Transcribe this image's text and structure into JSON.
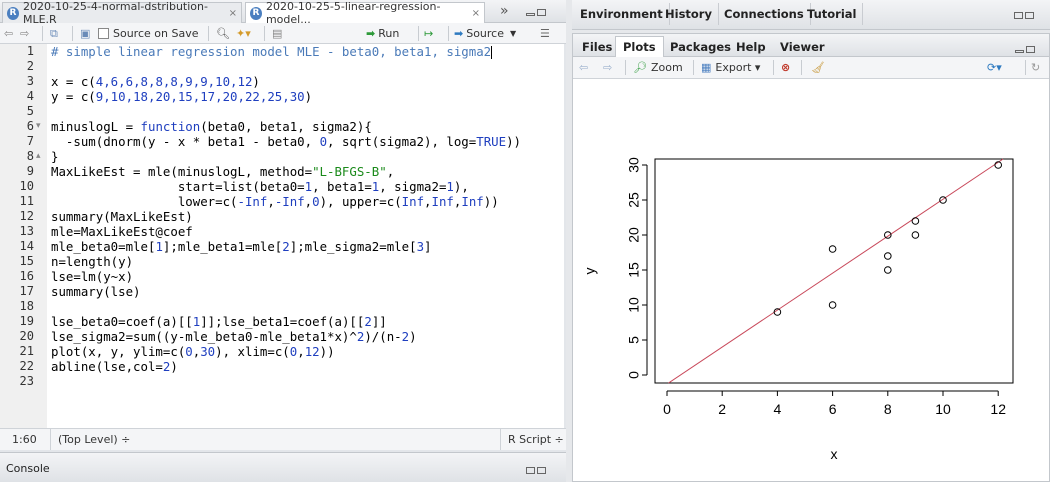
{
  "editor": {
    "tabs": [
      {
        "label": "2020-10-25-4-normal-dstribution-MLE.R",
        "close": "×"
      },
      {
        "label": "2020-10-25-5-linear-regression-model...",
        "close": "×"
      }
    ],
    "tab_overflow": "»",
    "toolbar": {
      "source_on_save": "Source on Save",
      "run": "Run",
      "source": "Source"
    },
    "lines": [
      {
        "n": "1",
        "fold": ""
      },
      {
        "n": "2",
        "fold": ""
      },
      {
        "n": "3",
        "fold": ""
      },
      {
        "n": "4",
        "fold": ""
      },
      {
        "n": "5",
        "fold": ""
      },
      {
        "n": "6",
        "fold": "▾"
      },
      {
        "n": "7",
        "fold": ""
      },
      {
        "n": "8",
        "fold": "▴"
      },
      {
        "n": "9",
        "fold": ""
      },
      {
        "n": "10",
        "fold": ""
      },
      {
        "n": "11",
        "fold": ""
      },
      {
        "n": "12",
        "fold": ""
      },
      {
        "n": "13",
        "fold": ""
      },
      {
        "n": "14",
        "fold": ""
      },
      {
        "n": "15",
        "fold": ""
      },
      {
        "n": "16",
        "fold": ""
      },
      {
        "n": "17",
        "fold": ""
      },
      {
        "n": "18",
        "fold": ""
      },
      {
        "n": "19",
        "fold": ""
      },
      {
        "n": "20",
        "fold": ""
      },
      {
        "n": "21",
        "fold": ""
      },
      {
        "n": "22",
        "fold": ""
      },
      {
        "n": "23",
        "fold": ""
      }
    ],
    "code": [
      [
        {
          "t": "# simple linear regression model MLE - beta0, beta1, sigma2",
          "c": "cm"
        }
      ],
      [],
      [
        {
          "t": "x = c(",
          "c": ""
        },
        {
          "t": "4,6,6,8,8,8,9,9,10,12",
          "c": "num"
        },
        {
          "t": ")",
          "c": ""
        }
      ],
      [
        {
          "t": "y = c(",
          "c": ""
        },
        {
          "t": "9,10,18,20,15,17,20,22,25,30",
          "c": "num"
        },
        {
          "t": ")",
          "c": ""
        }
      ],
      [],
      [
        {
          "t": "minuslogL = ",
          "c": ""
        },
        {
          "t": "function",
          "c": "kw"
        },
        {
          "t": "(beta0, beta1, sigma2){",
          "c": ""
        }
      ],
      [
        {
          "t": "  -sum(dnorm(y - x * beta1 - beta0, ",
          "c": ""
        },
        {
          "t": "0",
          "c": "num"
        },
        {
          "t": ", sqrt(sigma2), log=",
          "c": ""
        },
        {
          "t": "TRUE",
          "c": "kw"
        },
        {
          "t": "))",
          "c": ""
        }
      ],
      [
        {
          "t": "}",
          "c": ""
        }
      ],
      [
        {
          "t": "MaxLikeEst = mle(minuslogL, method=",
          "c": ""
        },
        {
          "t": "\"L-BFGS-B\"",
          "c": "str"
        },
        {
          "t": ",",
          "c": ""
        }
      ],
      [
        {
          "t": "                 start=list(beta0=",
          "c": ""
        },
        {
          "t": "1",
          "c": "num"
        },
        {
          "t": ", beta1=",
          "c": ""
        },
        {
          "t": "1",
          "c": "num"
        },
        {
          "t": ", sigma2=",
          "c": ""
        },
        {
          "t": "1",
          "c": "num"
        },
        {
          "t": "),",
          "c": ""
        }
      ],
      [
        {
          "t": "                 lower=c(",
          "c": ""
        },
        {
          "t": "-Inf",
          "c": "kw"
        },
        {
          "t": ",",
          "c": ""
        },
        {
          "t": "-Inf",
          "c": "kw"
        },
        {
          "t": ",",
          "c": ""
        },
        {
          "t": "0",
          "c": "num"
        },
        {
          "t": "), upper=c(",
          "c": ""
        },
        {
          "t": "Inf",
          "c": "kw"
        },
        {
          "t": ",",
          "c": ""
        },
        {
          "t": "Inf",
          "c": "kw"
        },
        {
          "t": ",",
          "c": ""
        },
        {
          "t": "Inf",
          "c": "kw"
        },
        {
          "t": "))",
          "c": ""
        }
      ],
      [
        {
          "t": "summary(MaxLikeEst)",
          "c": ""
        }
      ],
      [
        {
          "t": "mle=MaxLikeEst@coef",
          "c": ""
        }
      ],
      [
        {
          "t": "mle_beta0=mle[",
          "c": ""
        },
        {
          "t": "1",
          "c": "num"
        },
        {
          "t": "];mle_beta1=mle[",
          "c": ""
        },
        {
          "t": "2",
          "c": "num"
        },
        {
          "t": "];mle_sigma2=mle[",
          "c": ""
        },
        {
          "t": "3",
          "c": "num"
        },
        {
          "t": "]",
          "c": ""
        }
      ],
      [
        {
          "t": "n=length(y)",
          "c": ""
        }
      ],
      [
        {
          "t": "lse=lm(y~x)",
          "c": ""
        }
      ],
      [
        {
          "t": "summary(lse)",
          "c": ""
        }
      ],
      [],
      [
        {
          "t": "lse_beta0=coef(a)[[",
          "c": ""
        },
        {
          "t": "1",
          "c": "num"
        },
        {
          "t": "]];lse_beta1=coef(a)[[",
          "c": ""
        },
        {
          "t": "2",
          "c": "num"
        },
        {
          "t": "]]",
          "c": ""
        }
      ],
      [
        {
          "t": "lse_sigma2=sum((y-mle_beta0-mle_beta1*x)^",
          "c": ""
        },
        {
          "t": "2",
          "c": "num"
        },
        {
          "t": ")/(n-",
          "c": ""
        },
        {
          "t": "2",
          "c": "num"
        },
        {
          "t": ")",
          "c": ""
        }
      ],
      [
        {
          "t": "plot(x, y, ylim=c(",
          "c": ""
        },
        {
          "t": "0",
          "c": "num"
        },
        {
          "t": ",",
          "c": ""
        },
        {
          "t": "30",
          "c": "num"
        },
        {
          "t": "), xlim=c(",
          "c": ""
        },
        {
          "t": "0",
          "c": "num"
        },
        {
          "t": ",",
          "c": ""
        },
        {
          "t": "12",
          "c": "num"
        },
        {
          "t": "))",
          "c": ""
        }
      ],
      [
        {
          "t": "abline(lse,col=",
          "c": ""
        },
        {
          "t": "2",
          "c": "num"
        },
        {
          "t": ")",
          "c": ""
        }
      ],
      []
    ],
    "status": {
      "position": "1:60",
      "scope": "(Top Level) ÷",
      "filetype": "R Script ÷"
    }
  },
  "console": {
    "label": "Console"
  },
  "env_tabs": [
    "Environment",
    "History",
    "Connections",
    "Tutorial"
  ],
  "files_tabs": [
    "Files",
    "Plots",
    "Packages",
    "Help",
    "Viewer"
  ],
  "plot_toolbar": {
    "zoom": "Zoom",
    "export": "Export ▾"
  },
  "colors": {
    "regression_line": "#c8485a",
    "accent_blue": "#4b7fc0"
  },
  "chart_data": {
    "type": "scatter",
    "xlabel": "x",
    "ylabel": "y",
    "xlim": [
      0,
      12
    ],
    "ylim": [
      0,
      30
    ],
    "xticks": [
      0,
      2,
      4,
      6,
      8,
      10,
      12
    ],
    "yticks": [
      0,
      5,
      10,
      15,
      20,
      25,
      30
    ],
    "x": [
      4,
      6,
      6,
      8,
      8,
      8,
      9,
      9,
      10,
      12
    ],
    "y": [
      9,
      10,
      18,
      20,
      15,
      17,
      20,
      22,
      25,
      30
    ],
    "abline": {
      "intercept": -1.29,
      "slope": 2.64
    }
  }
}
